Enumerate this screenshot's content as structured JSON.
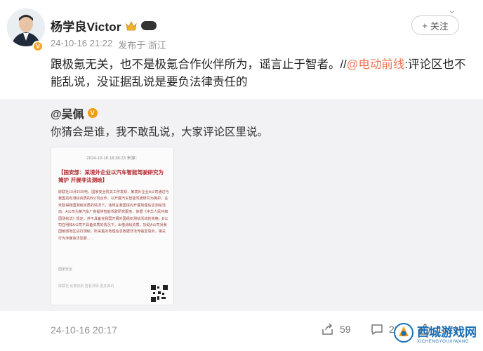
{
  "author": {
    "name": "杨学良Victor",
    "level_badge": "",
    "time": "24-10-16 21:22",
    "source": "发布于 浙江"
  },
  "follow_label": "关注",
  "post": {
    "text_before": "跟极氪无关，也不是极氪合作伙伴所为，谣言止于智者。//",
    "mention": "@电动前线",
    "text_after": ":评论区也不能乱说，没证据乱说是要负法律责任的"
  },
  "repost": {
    "author": "@吴佩",
    "text": "你猜会是谁，我不敢乱说，大家评论区里说。",
    "image": {
      "date_line": "2024-10-16 18:38:23 来源：",
      "headline": "【国安部：某境外企业以汽车智能驾驶研究为掩护 开展非法测绘】",
      "body": "财联社10月16日电，国家安全机关工作发现，某境外企业A公司通过与我国具有测绘资质的B公司合作，以开展汽车智能驾驶研究为掩护，在未取得我国测绘资质的情况下，违规在我国境内开展地理信息测绘活动。A公司为某汽车厂商提供智能驾驶研究服务，依据《中华人民共和国测绘法》规定，并不具备在我国开展外国组织测绘活动的资格。B公司在明知A公司不具备资质的情况下，出借测绘资质，协助A公司对我国敏感地区进行测绘，所采集的地理信息数据非法传输至境外，相关行为涉嫌违法犯罪……",
      "tag": "国家安全",
      "footer": "财联社 长按识别 查看详情 更多资讯"
    }
  },
  "footer": {
    "time": "24-10-16 20:17",
    "share_count": "59",
    "comment_count": "202",
    "like_count": "1871"
  },
  "watermark": {
    "title": "西城游戏网",
    "sub": "XICHENGYOUXIWANG"
  }
}
